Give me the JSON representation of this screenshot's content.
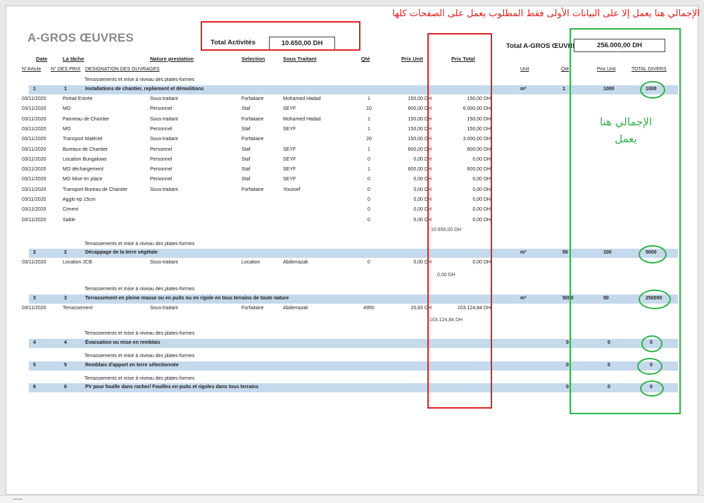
{
  "sheet_title": "A-GROS ŒUVRES",
  "total_activites": {
    "label": "Total Activités",
    "value": "10.650,00 DH"
  },
  "total_gros": {
    "label": "Total A-GROS ŒUVRES",
    "value": "256.000,00 DH"
  },
  "col_headers": {
    "date": "Date",
    "tache": "La tâche",
    "nature": "Nature prestation",
    "selection": "Selection",
    "sous_traitant": "Sous Traitant",
    "qte": "Qté",
    "prix_unit": "Prix Unit",
    "prix_total": "Prix Total"
  },
  "sub_headers": {
    "article": "N°Article",
    "des_prix": "N° DES PRIX",
    "designation": "DESIGNATION DES OUVRAGES"
  },
  "right_headers": {
    "unit": "Unit",
    "qte": "Qté",
    "prix_unit": "Prix Unit",
    "total_divers": "TOTAL DIVERS"
  },
  "section_heading": "Terrassements et mise à niveau des plates-formes",
  "articles": [
    {
      "art": "1",
      "num": "1",
      "designation": "Installations de chantier, repliement et démolitions",
      "unit": "m²",
      "qte": "1",
      "prix": "1000",
      "total": "1000"
    },
    {
      "art": "2",
      "num": "2",
      "designation": "Décappage de la terre végétale",
      "unit": "m²",
      "qte": "50",
      "prix": "100",
      "total": "5000"
    },
    {
      "art": "3",
      "num": "3",
      "designation": "Terrassement en pleine masse ou en puits ou en rigole en tous terrains de toute nature",
      "unit": "m²",
      "qte": "5000",
      "prix": "50",
      "total": "250000"
    },
    {
      "art": "4",
      "num": "4",
      "designation": "Évacuation ou mise en remblais",
      "unit": "",
      "qte": "0",
      "prix": "0",
      "total": "0"
    },
    {
      "art": "5",
      "num": "5",
      "designation": "Remblais d'apport en terre sélectionnée",
      "unit": "",
      "qte": "0",
      "prix": "0",
      "total": "0"
    },
    {
      "art": "6",
      "num": "6",
      "designation": "PV pour fouille dans rocher/  Fouilles en puits et rigoles dans tous terrains",
      "unit": "",
      "qte": "0",
      "prix": "0",
      "total": "0"
    }
  ],
  "tasks1": [
    {
      "date": "03/11/2020",
      "task": "Portail Entrée",
      "nature": "Sous-traitant",
      "sel": "Forfaitaire",
      "st": "Mohamed Hadad",
      "qte": "1",
      "pu": "150,00 DH",
      "pt": "150,00 DH"
    },
    {
      "date": "03/11/2020",
      "task": "MO",
      "nature": "Personnel",
      "sel": "Staf",
      "st": "SEYF",
      "qte": "10",
      "pu": "600,00 DH",
      "pt": "6.000,00 DH"
    },
    {
      "date": "03/11/2020",
      "task": "Panneau de Chantier",
      "nature": "Sous-traitant",
      "sel": "Forfaitaire",
      "st": "Mohamed Hadad",
      "qte": "1",
      "pu": "150,00 DH",
      "pt": "150,00 DH"
    },
    {
      "date": "03/11/2020",
      "task": "MO",
      "nature": "Personnel",
      "sel": "Staf",
      "st": "SEYF",
      "qte": "1",
      "pu": "150,00 DH",
      "pt": "150,00 DH"
    },
    {
      "date": "03/11/2020",
      "task": "Transport Matériel",
      "nature": "Sous-traitant",
      "sel": "Forfaitaire",
      "st": "",
      "qte": "20",
      "pu": "150,00 DH",
      "pt": "3.000,00 DH"
    },
    {
      "date": "03/11/2020",
      "task": "Bureaux de Chantier",
      "nature": "Personnel",
      "sel": "Staf",
      "st": "SEYF",
      "qte": "1",
      "pu": "600,00 DH",
      "pt": "600,00 DH"
    },
    {
      "date": "03/11/2020",
      "task": "Location Bungalows",
      "nature": "Personnel",
      "sel": "Staf",
      "st": "SEYF",
      "qte": "0",
      "pu": "0,00 DH",
      "pt": "0,00 DH"
    },
    {
      "date": "03/11/2020",
      "task": "MO déchargement",
      "nature": "Personnel",
      "sel": "Staf",
      "st": "SEYF",
      "qte": "1",
      "pu": "600,00 DH",
      "pt": "600,00 DH"
    },
    {
      "date": "03/11/2020",
      "task": "MO Mise en place",
      "nature": "Personnel",
      "sel": "Staf",
      "st": "SEYF",
      "qte": "0",
      "pu": "0,00 DH",
      "pt": "0,00 DH"
    },
    {
      "date": "03/11/2020",
      "task": "Transport Bureau de Chantier",
      "nature": "Sous-traitant",
      "sel": "Forfaitaire",
      "st": "Youssef",
      "qte": "0",
      "pu": "0,00 DH",
      "pt": "0,00 DH"
    },
    {
      "date": "03/11/2020",
      "task": "Agglo ep 15cm",
      "nature": "",
      "sel": "",
      "st": "",
      "qte": "0",
      "pu": "0,00 DH",
      "pt": "0,00 DH"
    },
    {
      "date": "03/11/2020",
      "task": "Ciment",
      "nature": "",
      "sel": "",
      "st": "",
      "qte": "0",
      "pu": "0,00 DH",
      "pt": "0,00 DH"
    },
    {
      "date": "03/11/2020",
      "task": "Sable",
      "nature": "",
      "sel": "",
      "st": "",
      "qte": "0",
      "pu": "0,00 DH",
      "pt": "0,00 DH"
    }
  ],
  "subtotal1": "10.650,00 DH",
  "task2": {
    "date": "03/11/2020",
    "task": "Location JCB",
    "nature": "Sous-traitant",
    "sel": "Location",
    "st": "Abderrazak",
    "qte": "0",
    "pu": "0,00 DH",
    "pt": "0,00 DH"
  },
  "subtotal2": "0,00 DH",
  "task3": {
    "date": "03/11/2020",
    "task": "Terrassement",
    "nature": "Sous-traitant",
    "sel": "Forfaitaire",
    "st": "Abderrazak",
    "qte": "4950",
    "pu": "20,83 DH",
    "pt": "103.124,84 DH"
  },
  "subtotal3": "103.124,84 DH",
  "annotations": {
    "red_note": "الإجمالي هنا يعمل إلا على البيانات الأولى فقط المطلوب يعمل على الصفحات كلها",
    "green_line1": "الإجمالي هنا",
    "green_line2": "يعمل"
  },
  "colors": {
    "band": "#c5d9ec",
    "red": "#e02020",
    "green": "#2fb34a",
    "title": "#8a8a8a"
  }
}
